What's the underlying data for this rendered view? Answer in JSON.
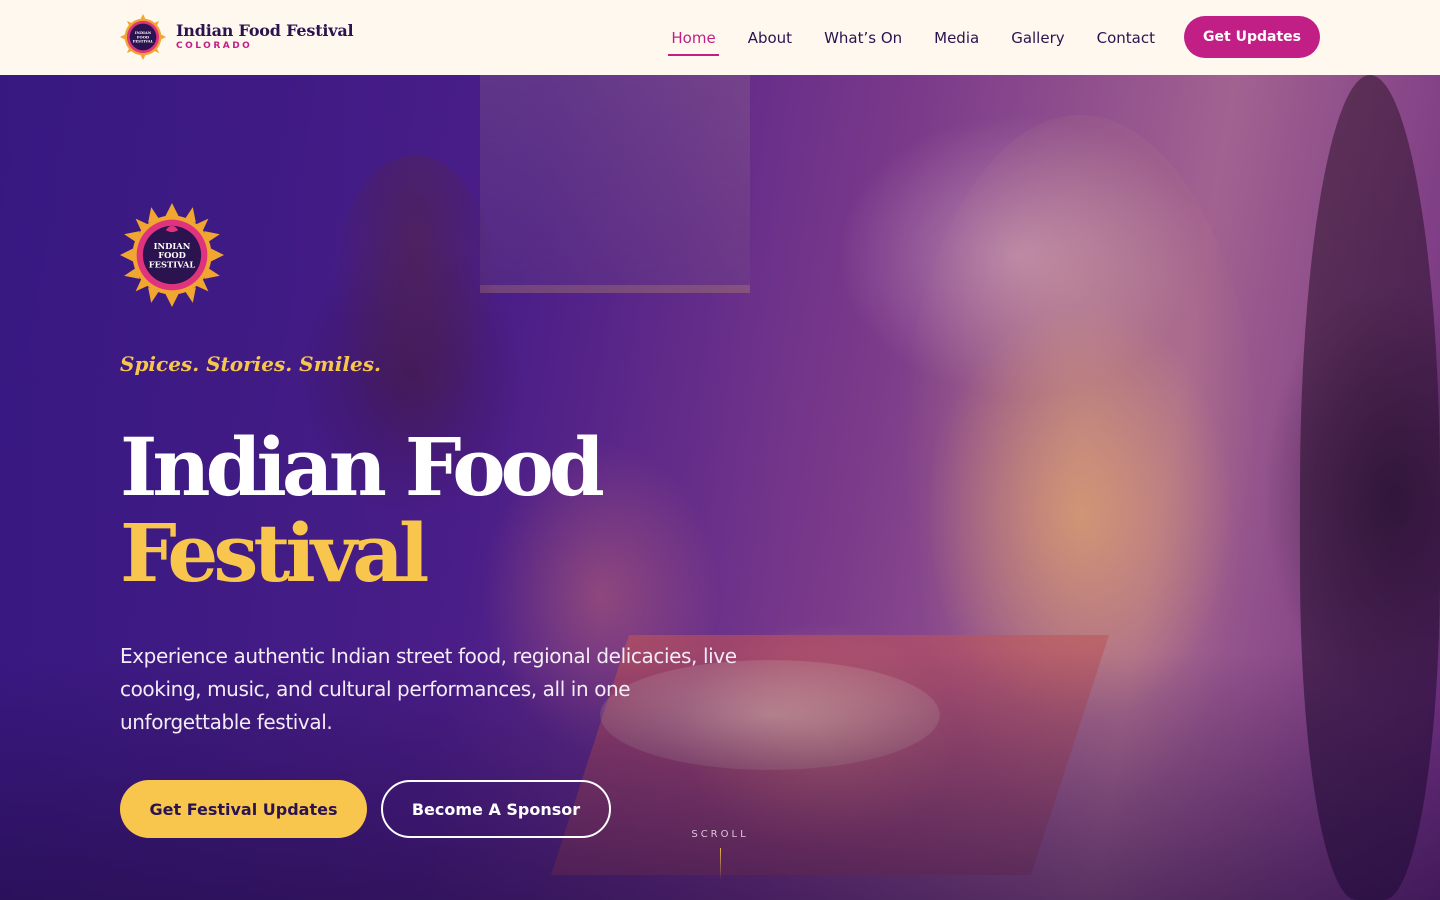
{
  "header": {
    "logo_icon": "festival-badge-icon",
    "brand_name": "Indian Food Festival",
    "brand_sub": "COLORADO",
    "nav": [
      {
        "label": "Home",
        "active": true
      },
      {
        "label": "About"
      },
      {
        "label": "What’s On"
      },
      {
        "label": "Media"
      },
      {
        "label": "Gallery"
      },
      {
        "label": "Contact"
      }
    ],
    "cta_label": "Get Updates"
  },
  "hero": {
    "badge_icon": "festival-badge-icon",
    "badge_lines": [
      "INDIAN",
      "FOOD",
      "FESTIVAL"
    ],
    "tagline": "Spices. Stories. Smiles.",
    "title_line1": "Indian Food",
    "title_line2": "Festival",
    "description": "Experience authentic Indian street food, regional delicacies, live cooking, music, and cultural performances, all in one unforgettable festival.",
    "primary_button": "Get Festival Updates",
    "secondary_button": "Become A Sponsor",
    "scroll_label": "SCROLL"
  },
  "colors": {
    "accent_magenta": "#c21f86",
    "accent_gold": "#f8c64c",
    "deep_purple": "#2b1350",
    "header_bg": "#fff8ef"
  }
}
